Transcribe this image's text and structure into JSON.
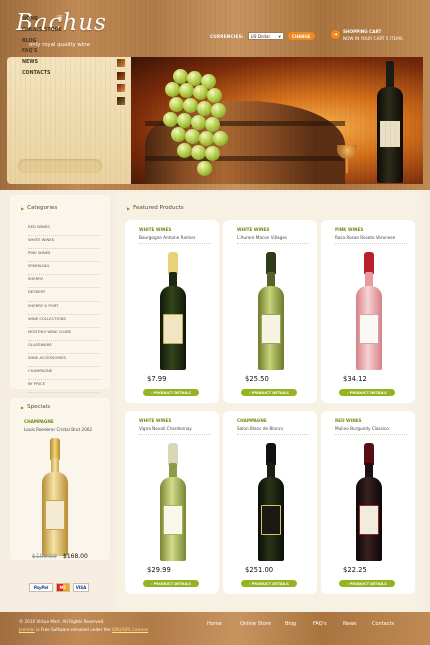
{
  "header": {
    "logo_text": "Bachus",
    "tagline": "only royal quality wine",
    "currencies_label": "CURRENCIES:",
    "currency_value": "US Dollar",
    "change_button": "CHANGE",
    "cart_title": "SHOPPING CART",
    "cart_status": "NOW IN YOUR CART 5 ITEMS"
  },
  "menu": [
    "HOME",
    "ONLINE STORE",
    "BLOG",
    "FAQ'S",
    "NEWS",
    "CONTACTS"
  ],
  "sidebar": {
    "categories_title": "Categories",
    "categories": [
      "RED WINES",
      "WHITE WINES",
      "PINK WINES",
      "SPARKLING",
      "SHERRY",
      "DESSERT",
      "SHERRY & PORT",
      "WINE COLLECTIONS",
      "MONTHLY WINE CLUBS",
      "GLASSWARE",
      "WINE ACCESSORIES",
      "CHAMPAGNE",
      "BY PRICE"
    ],
    "specials_title": "Specials",
    "special": {
      "category": "CHAMPAGNE",
      "name": "Louis Roederer Cristal Brut 2002",
      "old_price": "$199.99",
      "new_price": "$168.00"
    },
    "payments": [
      "PayPal",
      "MC",
      "VISA"
    ]
  },
  "featured": {
    "title": "Featured Products",
    "button_label": "PRODUCT DETAILS",
    "products": [
      {
        "category": "WHITE WINES",
        "name": "Bourgogne Antoine Ramier",
        "price": "$7.99"
      },
      {
        "category": "WHITE WINES",
        "name": "L'Aurore Macon Villages",
        "price": "$25.50"
      },
      {
        "category": "PINK WINES",
        "name": "Rosa Rosae Rosato Veronese",
        "price": "$34.12"
      },
      {
        "category": "WHITE WINES",
        "name": "Vigna Novali Chardonnay",
        "price": "$29.99"
      },
      {
        "category": "CHAMPAGNE",
        "name": "Salon Blanc de Blancs",
        "price": "$251.00"
      },
      {
        "category": "RED WINES",
        "name": "Mulino Burgundy Classico",
        "price": "$22.25"
      }
    ]
  },
  "footer": {
    "copyright": "© 2010 Virtue Mart. All Rights Reserved.",
    "joomla_link": "Joomla!",
    "license_text": " is Free Software released under the ",
    "gnu_link": "GNU/GPL Licence",
    "nav": [
      "Home",
      "Online Store",
      "Blog",
      "FAQ's",
      "News",
      "Contacts"
    ]
  },
  "colors": {
    "accent_green": "#93b321",
    "accent_orange": "#f28a1d",
    "wood": "#b17b48"
  },
  "icons": [
    "grape-leaf-icon",
    "cart-icon",
    "bullet-arrow-icon",
    "select-arrow-icon"
  ]
}
